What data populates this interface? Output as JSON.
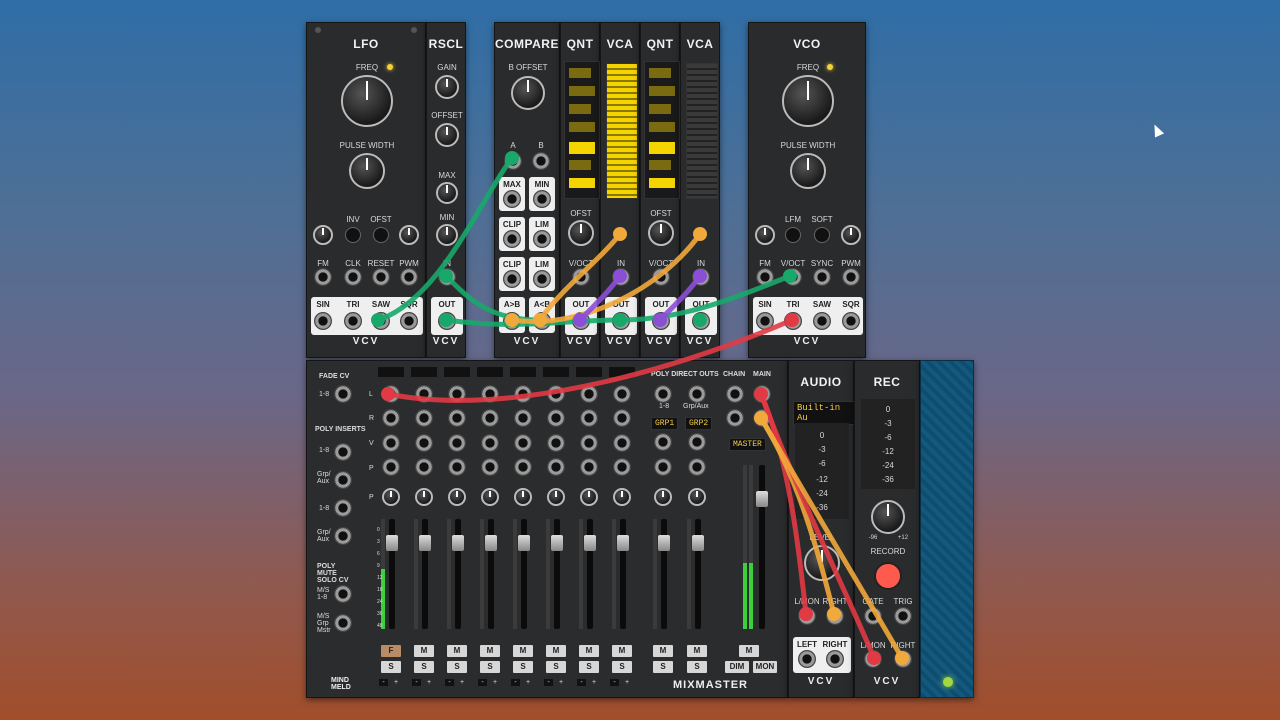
{
  "modules": {
    "lfo": {
      "title": "LFO",
      "freq": "FREQ",
      "pw": "PULSE WIDTH",
      "inv": "INV",
      "ofst": "OFST",
      "fm": "FM",
      "clk": "CLK",
      "reset": "RESET",
      "pwm": "PWM",
      "sin": "SIN",
      "tri": "TRI",
      "saw": "SAW",
      "sqr": "SQR",
      "brand": "VCV"
    },
    "rscl": {
      "title": "RSCL",
      "gain": "GAIN",
      "offset": "OFFSET",
      "max": "MAX",
      "min": "MIN",
      "in": "IN",
      "out": "OUT",
      "brand": "VCV"
    },
    "compare": {
      "title": "COMPARE",
      "boffset": "B OFFSET",
      "a": "A",
      "b": "B",
      "max": "MAX",
      "min": "MIN",
      "clip1": "CLIP",
      "lim1": "LIM",
      "clip2": "CLIP",
      "lim2": "LIM",
      "agtb": "A>B",
      "altb": "A<B",
      "brand": "VCV"
    },
    "qnt1": {
      "title": "QNT",
      "ofst": "OFST",
      "voct": "V/OCT",
      "out": "OUT",
      "brand": "VCV"
    },
    "vca1": {
      "title": "VCA",
      "in": "IN",
      "out": "OUT",
      "brand": "VCV"
    },
    "qnt2": {
      "title": "QNT",
      "ofst": "OFST",
      "voct": "V/OCT",
      "out": "OUT",
      "brand": "VCV"
    },
    "vca2": {
      "title": "VCA",
      "in": "IN",
      "out": "OUT",
      "brand": "VCV"
    },
    "vco": {
      "title": "VCO",
      "freq": "FREQ",
      "pw": "PULSE WIDTH",
      "lfm": "LFM",
      "soft": "SOFT",
      "fm": "FM",
      "voct": "V/OCT",
      "sync": "SYNC",
      "pwm": "PWM",
      "sin": "SIN",
      "tri": "TRI",
      "saw": "SAW",
      "sqr": "SQR",
      "brand": "VCV"
    }
  },
  "mixer": {
    "fade_cv": "FADE CV",
    "one_eight": "1-8",
    "poly_inserts": "POLY INSERTS",
    "grp_aux": "Grp/ Aux",
    "poly_mute": "POLY MUTE SOLO CV",
    "ms18": "M/S 1-8",
    "msgrp": "M/S Grp Mstr",
    "poly_direct": "POLY DIRECT OUTS",
    "pd18": "1-8",
    "pdgrp": "Grp/Aux",
    "grp1": "GRP1",
    "grp2": "GRP2",
    "chain": "CHAIN",
    "main": "MAIN",
    "master": "MASTER",
    "row_l": "L",
    "row_r": "R",
    "row_v": "V",
    "row_p": "P",
    "row_p2": "P",
    "f_btn": "F",
    "m_btn": "M",
    "s_btn": "S",
    "dim": "DIM",
    "mon": "MON",
    "minus": "-",
    "plus": "+",
    "brand_left": "MIND MELD",
    "brand_right": "MIXMASTER",
    "scale": [
      "0",
      "3",
      "6",
      "9",
      "12",
      "18",
      "24",
      "36",
      "48"
    ]
  },
  "audio": {
    "title": "AUDIO",
    "device": "Built-in Au",
    "levels": [
      "0",
      "-3",
      "-6",
      "-12",
      "-24",
      "-36"
    ],
    "level": "LEVEL",
    "lmon": "L/MON",
    "right": "RIGHT",
    "left": "LEFT",
    "right2": "RIGHT",
    "brand": "VCV"
  },
  "rec": {
    "title": "REC",
    "levels": [
      "0",
      "-3",
      "-6",
      "-12",
      "-24",
      "-36"
    ],
    "knob_min": "-96",
    "knob_max": "+12",
    "record": "RECORD",
    "gate": "GATE",
    "trig": "TRIG",
    "lmon": "L/MON",
    "right": "RIGHT",
    "brand": "VCV"
  },
  "colors": {
    "green": "#17a86a",
    "orange": "#f2a93b",
    "red": "#e23a44",
    "purple": "#8b4fd6",
    "yellow": "#f5d500"
  },
  "icons": [
    "mouse-cursor-icon",
    "screw-icon",
    "jack-icon"
  ]
}
